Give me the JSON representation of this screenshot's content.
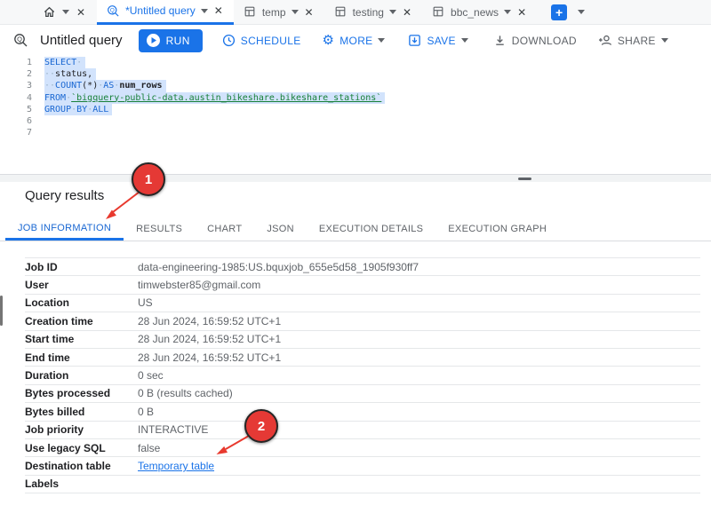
{
  "tabbar": {
    "tabs": [
      {
        "label": "*Untitled query",
        "icon": "query-icon",
        "active": true
      },
      {
        "label": "temp",
        "icon": "table-icon",
        "active": false
      },
      {
        "label": "testing",
        "icon": "table-icon",
        "active": false
      },
      {
        "label": "bbc_news",
        "icon": "table-icon",
        "active": false
      }
    ],
    "new_tab_label": "+"
  },
  "toolbar": {
    "title": "Untitled query",
    "run_label": "RUN",
    "schedule_label": "SCHEDULE",
    "more_label": "MORE",
    "save_label": "SAVE",
    "download_label": "DOWNLOAD",
    "share_label": "SHARE"
  },
  "editor": {
    "lines": [
      {
        "num": "1",
        "tokens": [
          [
            "kw",
            "SELECT"
          ],
          [
            "ws",
            "·"
          ]
        ]
      },
      {
        "num": "2",
        "tokens": [
          [
            "ws",
            "··"
          ],
          [
            "txt",
            "status,"
          ]
        ]
      },
      {
        "num": "3",
        "tokens": [
          [
            "ws",
            "··"
          ],
          [
            "kw",
            "COUNT"
          ],
          [
            "txt",
            "(*)"
          ],
          [
            "ws",
            "·"
          ],
          [
            "kw",
            "AS"
          ],
          [
            "ws",
            "·"
          ],
          [
            "bold",
            "num_rows"
          ]
        ]
      },
      {
        "num": "4",
        "tokens": [
          [
            "kw",
            "FROM"
          ],
          [
            "ws",
            "·"
          ],
          [
            "tbl",
            "`bigquery-public-data.austin_bikeshare.bikeshare_stations`"
          ]
        ]
      },
      {
        "num": "5",
        "tokens": [
          [
            "kw",
            "GROUP"
          ],
          [
            "ws",
            "·"
          ],
          [
            "kw",
            "BY"
          ],
          [
            "ws",
            "·"
          ],
          [
            "kw",
            "ALL"
          ]
        ]
      },
      {
        "num": "6",
        "tokens": []
      },
      {
        "num": "7",
        "tokens": []
      }
    ]
  },
  "results": {
    "heading": "Query results",
    "active_tab": "JOB INFORMATION",
    "tabs": [
      "JOB INFORMATION",
      "RESULTS",
      "CHART",
      "JSON",
      "EXECUTION DETAILS",
      "EXECUTION GRAPH"
    ],
    "rows": [
      {
        "label": "Job ID",
        "value": "data-engineering-1985:US.bquxjob_655e5d58_1905f930ff7"
      },
      {
        "label": "User",
        "value": "timwebster85@gmail.com"
      },
      {
        "label": "Location",
        "value": "US"
      },
      {
        "label": "Creation time",
        "value": "28 Jun 2024, 16:59:52 UTC+1"
      },
      {
        "label": "Start time",
        "value": "28 Jun 2024, 16:59:52 UTC+1"
      },
      {
        "label": "End time",
        "value": "28 Jun 2024, 16:59:52 UTC+1"
      },
      {
        "label": "Duration",
        "value": "0 sec"
      },
      {
        "label": "Bytes processed",
        "value": "0 B (results cached)"
      },
      {
        "label": "Bytes billed",
        "value": "0 B"
      },
      {
        "label": "Job priority",
        "value": "INTERACTIVE"
      },
      {
        "label": "Use legacy SQL",
        "value": "false"
      },
      {
        "label": "Destination table",
        "value": "Temporary table",
        "link": true
      },
      {
        "label": "Labels",
        "value": ""
      }
    ]
  },
  "annotations": [
    {
      "number": "1"
    },
    {
      "number": "2"
    }
  ],
  "colors": {
    "accent_blue": "#1a73e8",
    "keyword_blue": "#1967d2",
    "table_ref_green": "#188038",
    "selection_blue": "#d2e3fc",
    "annotation_red": "#e53935",
    "gray_text": "#5f6368"
  }
}
